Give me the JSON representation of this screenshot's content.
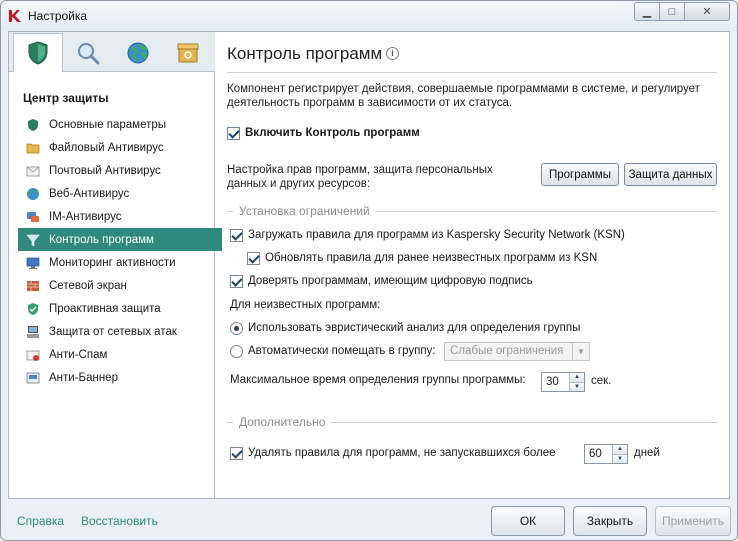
{
  "window": {
    "title": "Настройка"
  },
  "sidebar": {
    "tabs": [
      {
        "icon": "shield-icon",
        "active": true
      },
      {
        "icon": "magnifier-icon",
        "active": false
      },
      {
        "icon": "globe-icon",
        "active": false
      },
      {
        "icon": "box-icon",
        "active": false
      }
    ],
    "title": "Центр защиты",
    "items": [
      {
        "label": "Основные параметры",
        "icon": "shield-icon",
        "active": false
      },
      {
        "label": "Файловый Антивирус",
        "icon": "folder-icon",
        "active": false
      },
      {
        "label": "Почтовый Антивирус",
        "icon": "mail-icon",
        "active": false
      },
      {
        "label": "Веб-Антивирус",
        "icon": "globe-icon",
        "active": false
      },
      {
        "label": "IM-Антивирус",
        "icon": "chat-icon",
        "active": false
      },
      {
        "label": "Контроль программ",
        "icon": "funnel-icon",
        "active": true
      },
      {
        "label": "Мониторинг активности",
        "icon": "monitor-icon",
        "active": false
      },
      {
        "label": "Сетевой экран",
        "icon": "firewall-icon",
        "active": false
      },
      {
        "label": "Проактивная защита",
        "icon": "proactive-icon",
        "active": false
      },
      {
        "label": "Защита от сетевых атак",
        "icon": "network-icon",
        "active": false
      },
      {
        "label": "Анти-Спам",
        "icon": "spam-icon",
        "active": false
      },
      {
        "label": "Анти-Баннер",
        "icon": "banner-icon",
        "active": false
      }
    ]
  },
  "main": {
    "title": "Контроль программ",
    "description": "Компонент регистрирует действия, совершаемые программами в системе, и регулирует деятельность программ в зависимости от их статуса.",
    "enable_label": "Включить Контроль программ",
    "rights_text": "Настройка прав программ, защита персональных данных и других ресурсов:",
    "programs_button": "Программы",
    "data_protection_button": "Защита данных",
    "restrictions_section": "Установка ограничений",
    "ksn_label": "Загружать правила для программ из Kaspersky Security Network (KSN)",
    "ksn_update_label": "Обновлять правила для ранее неизвестных программ из KSN",
    "trust_signed_label": "Доверять программам, имеющим цифровую подпись",
    "unknown_programs_label": "Для неизвестных программ:",
    "heuristic_label": "Использовать эвристический анализ для определения группы",
    "auto_group_label": "Автоматически помещать в группу:",
    "auto_group_value": "Слабые ограничения",
    "max_time_label": "Максимальное время определения группы программы:",
    "max_time_value": "30",
    "max_time_unit": "сек.",
    "additional_section": "Дополнительно",
    "delete_rules_label": "Удалять правила для программ, не запускавшихся более",
    "delete_days_value": "60",
    "delete_days_unit": "дней"
  },
  "footer": {
    "help_link": "Справка",
    "restore_link": "Восстановить",
    "ok_button": "ОК",
    "close_button": "Закрыть",
    "apply_button": "Применить"
  },
  "colors": {
    "accent": "#2f8a7d",
    "link": "#2f8a7d"
  }
}
